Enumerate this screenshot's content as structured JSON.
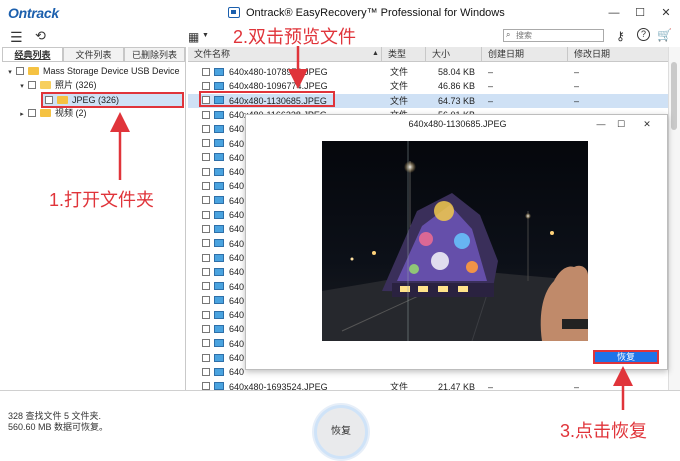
{
  "app": {
    "logo": "Ontrack",
    "title": "Ontrack® EasyRecovery™ Professional for Windows"
  },
  "window_controls": {
    "minimize": "—",
    "maximize": "☐",
    "close": "✕"
  },
  "toolbar": {
    "menu_icon": "menu-icon",
    "back_icon": "back-icon",
    "search_placeholder": "搜索"
  },
  "left_tabs": [
    {
      "label": "经典列表",
      "active": true
    },
    {
      "label": "文件列表",
      "active": false
    },
    {
      "label": "已删除列表",
      "active": false
    }
  ],
  "tree": [
    {
      "label": "Mass Storage Device USB Device",
      "expander": "▾"
    },
    {
      "label": "照片 (326)",
      "expander": "▾"
    },
    {
      "label": "JPEG (326)",
      "expander": ""
    },
    {
      "label": "视频 (2)",
      "expander": "▸"
    }
  ],
  "table": {
    "columns": [
      "文件名称",
      "类型",
      "大小",
      "创建日期",
      "修改日期"
    ],
    "rows": [
      {
        "name": "640x480-1078974.JPEG",
        "type": "文件",
        "size": "58.04 KB",
        "created": "–",
        "modified": "–"
      },
      {
        "name": "640x480-1096774.JPEG",
        "type": "文件",
        "size": "46.86 KB",
        "created": "–",
        "modified": "–"
      },
      {
        "name": "640x480-1130685.JPEG",
        "type": "文件",
        "size": "64.73 KB",
        "created": "–",
        "modified": "–"
      },
      {
        "name": "640x480-1166238.JPEG",
        "type": "文件",
        "size": "56.01 KB",
        "created": "–",
        "modified": "–"
      },
      {
        "name": "640",
        "type": "",
        "size": "",
        "created": "",
        "modified": ""
      },
      {
        "name": "640",
        "type": "",
        "size": "",
        "created": "",
        "modified": ""
      },
      {
        "name": "640",
        "type": "",
        "size": "",
        "created": "",
        "modified": ""
      },
      {
        "name": "640",
        "type": "",
        "size": "",
        "created": "",
        "modified": ""
      },
      {
        "name": "640",
        "type": "",
        "size": "",
        "created": "",
        "modified": ""
      },
      {
        "name": "640",
        "type": "",
        "size": "",
        "created": "",
        "modified": ""
      },
      {
        "name": "640",
        "type": "",
        "size": "",
        "created": "",
        "modified": ""
      },
      {
        "name": "640",
        "type": "",
        "size": "",
        "created": "",
        "modified": ""
      },
      {
        "name": "640",
        "type": "",
        "size": "",
        "created": "",
        "modified": ""
      },
      {
        "name": "640",
        "type": "",
        "size": "",
        "created": "",
        "modified": ""
      },
      {
        "name": "640",
        "type": "",
        "size": "",
        "created": "",
        "modified": ""
      },
      {
        "name": "640",
        "type": "",
        "size": "",
        "created": "",
        "modified": ""
      },
      {
        "name": "640",
        "type": "",
        "size": "",
        "created": "",
        "modified": ""
      },
      {
        "name": "640",
        "type": "",
        "size": "",
        "created": "",
        "modified": ""
      },
      {
        "name": "640",
        "type": "",
        "size": "",
        "created": "",
        "modified": ""
      },
      {
        "name": "640",
        "type": "",
        "size": "",
        "created": "",
        "modified": ""
      },
      {
        "name": "640",
        "type": "",
        "size": "",
        "created": "",
        "modified": ""
      },
      {
        "name": "640",
        "type": "",
        "size": "",
        "created": "",
        "modified": ""
      },
      {
        "name": "640x480-1693524.JPEG",
        "type": "文件",
        "size": "21.47 KB",
        "created": "–",
        "modified": "–"
      }
    ],
    "selected_index": 2
  },
  "preview": {
    "title": "640x480-1130685.JPEG",
    "restore_label": "恢复"
  },
  "status": {
    "line1": "328 查找文件 5 文件夹.",
    "line2": "560.60 MB 数据可恢复。"
  },
  "recover_button": "恢复",
  "annotations": {
    "step1": "1.打开文件夹",
    "step2": "2.双击预览文件",
    "step3": "3.点击恢复"
  },
  "colors": {
    "accent": "#1e73e8",
    "annotation_red": "#e0343a",
    "selection": "#cfe1f5"
  }
}
